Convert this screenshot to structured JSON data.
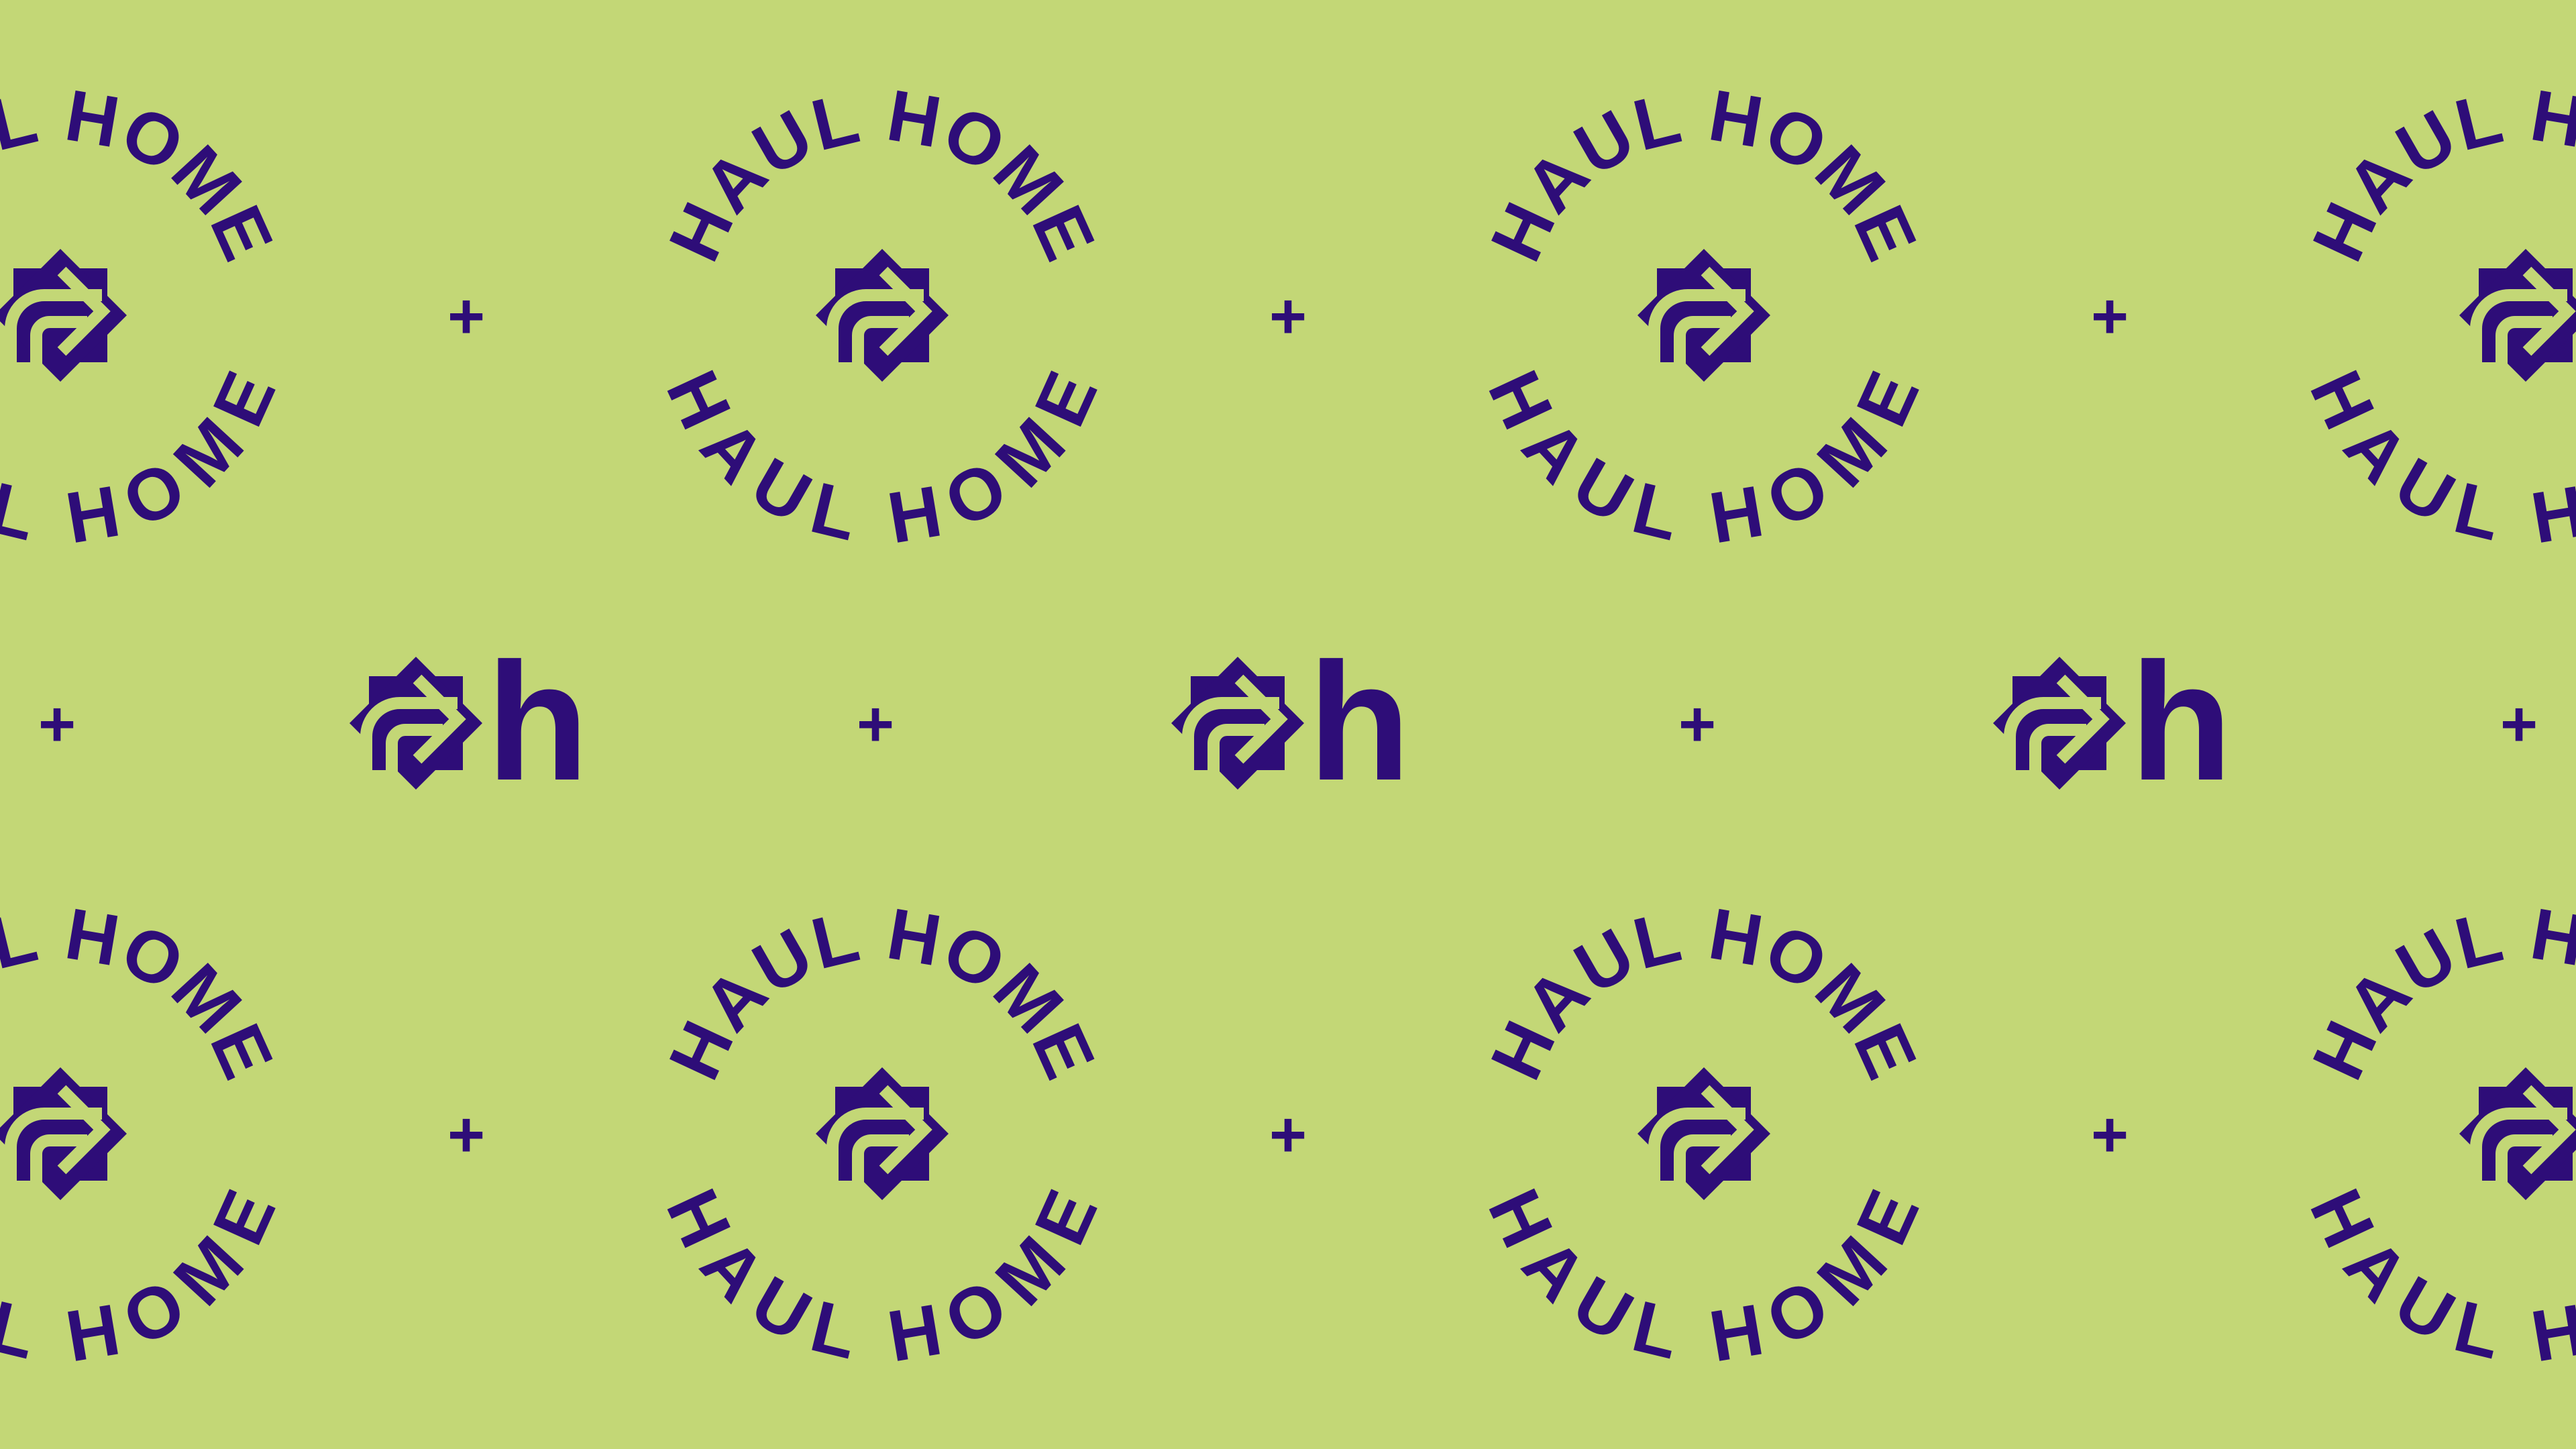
{
  "brand": {
    "badge_text_top": "HAUL HOME",
    "badge_text_bottom": "HAUL HOME",
    "wordmark_letter": "h",
    "separator": "+"
  },
  "colors": {
    "background": "#c3d776",
    "ink": "#2e0d78"
  },
  "icon": "haul-home-star-arrow-icon"
}
